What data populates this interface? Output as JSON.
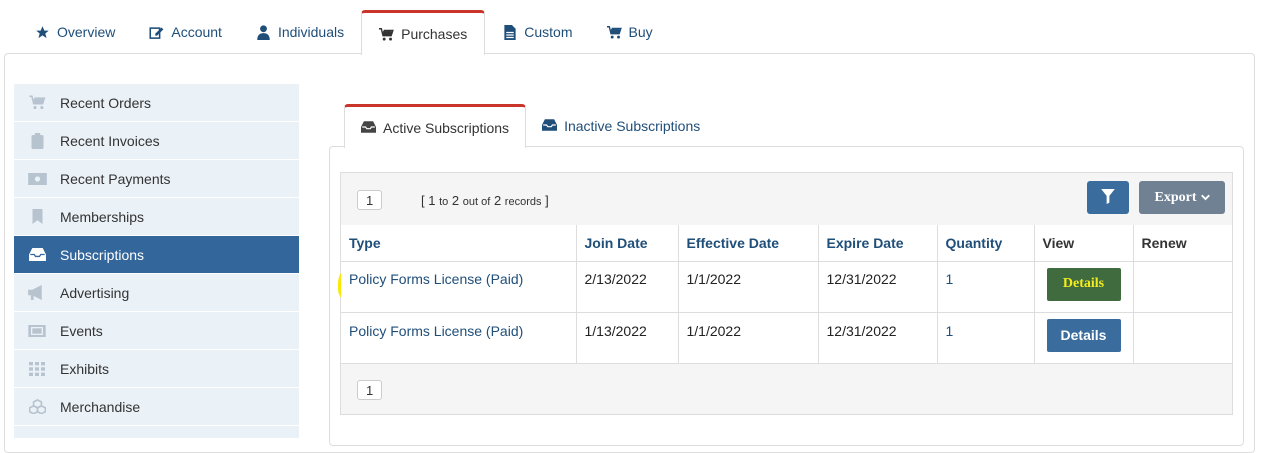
{
  "top_tabs": [
    {
      "label": "Overview",
      "icon": "star-icon"
    },
    {
      "label": "Account",
      "icon": "edit-icon"
    },
    {
      "label": "Individuals",
      "icon": "user-icon"
    },
    {
      "label": "Purchases",
      "icon": "cart-icon",
      "active": true
    },
    {
      "label": "Custom",
      "icon": "file-icon"
    },
    {
      "label": "Buy",
      "icon": "cart-icon"
    }
  ],
  "sidebar": {
    "items": [
      {
        "label": "Recent Orders",
        "icon": "cart-icon"
      },
      {
        "label": "Recent Invoices",
        "icon": "clipboard-icon"
      },
      {
        "label": "Recent Payments",
        "icon": "money-icon"
      },
      {
        "label": "Memberships",
        "icon": "bookmark-icon"
      },
      {
        "label": "Subscriptions",
        "icon": "inbox-icon",
        "active": true
      },
      {
        "label": "Advertising",
        "icon": "megaphone-icon"
      },
      {
        "label": "Events",
        "icon": "ticket-icon"
      },
      {
        "label": "Exhibits",
        "icon": "grid-icon"
      },
      {
        "label": "Merchandise",
        "icon": "cubes-icon"
      }
    ]
  },
  "inner_tabs": [
    {
      "label": "Active Subscriptions",
      "icon": "inbox-icon",
      "active": true
    },
    {
      "label": "Inactive Subscriptions",
      "icon": "inbox-icon"
    }
  ],
  "grid": {
    "page_top": "1",
    "page_bottom": "1",
    "records": {
      "open": "[",
      "start": "1",
      "to": "to",
      "end": "2",
      "out_of": "out of",
      "total": "2",
      "records": "records",
      "close": "]"
    },
    "export_label": "Export",
    "columns": [
      "Type",
      "Join Date",
      "Effective Date",
      "Expire Date",
      "Quantity",
      "View",
      "Renew"
    ],
    "rows": [
      {
        "type": "Policy Forms License (Paid)",
        "join": "2/13/2022",
        "effective": "1/1/2022",
        "expire": "12/31/2022",
        "quantity": "1",
        "view": "Details",
        "renew": ""
      },
      {
        "type": "Policy Forms License (Paid)",
        "join": "1/13/2022",
        "effective": "1/1/2022",
        "expire": "12/31/2022",
        "quantity": "1",
        "view": "Details",
        "renew": ""
      }
    ]
  },
  "colors": {
    "accent": "#33669a",
    "tab_border": "#c9342b",
    "highlight": "#fbe804"
  }
}
